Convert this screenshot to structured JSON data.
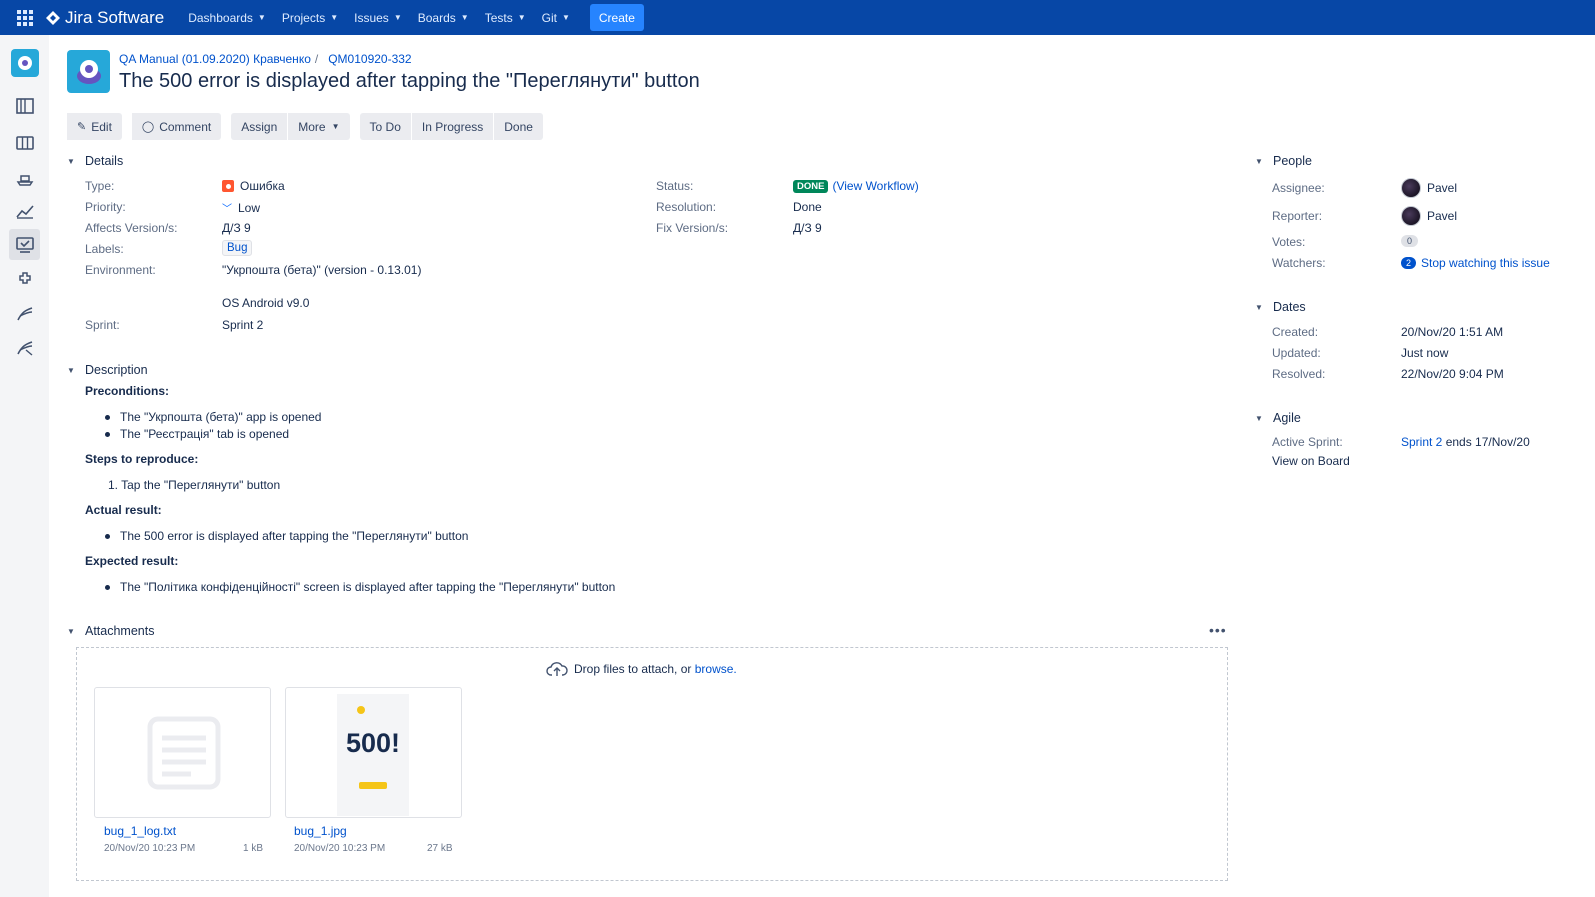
{
  "app": {
    "name": "Jira Software"
  },
  "nav": [
    {
      "label": "Dashboards"
    },
    {
      "label": "Projects"
    },
    {
      "label": "Issues"
    },
    {
      "label": "Boards"
    },
    {
      "label": "Tests"
    },
    {
      "label": "Git"
    }
  ],
  "create_label": "Create",
  "breadcrumb": {
    "project": "QA Manual (01.09.2020) Кравченко",
    "separator": "/",
    "issue_key": "QM010920-332"
  },
  "issue": {
    "title": "The 500 error is displayed after tapping the \"Переглянути\" button"
  },
  "toolbar": {
    "edit": "Edit",
    "comment": "Comment",
    "assign": "Assign",
    "more": "More",
    "todo": "To Do",
    "in_progress": "In Progress",
    "done": "Done"
  },
  "details": {
    "heading": "Details",
    "type_label": "Type:",
    "type_value": "Ошибка",
    "priority_label": "Priority:",
    "priority_value": "Low",
    "affects_label": "Affects Version/s:",
    "affects_value": "Д/З 9",
    "labels_label": "Labels:",
    "labels_value": "Bug",
    "environment_label": "Environment:",
    "environment_line1": "\"Укрпошта (бета)\" (version - 0.13.01)",
    "environment_line2": "OS Android v9.0",
    "sprint_label": "Sprint:",
    "sprint_value": "Sprint 2",
    "status_label": "Status:",
    "status_value": "DONE",
    "view_workflow": "(View Workflow)",
    "resolution_label": "Resolution:",
    "resolution_value": "Done",
    "fix_label": "Fix Version/s:",
    "fix_value": "Д/З 9"
  },
  "description": {
    "heading": "Description",
    "preconditions_title": "Preconditions:",
    "preconditions": [
      "The \"Укрпошта (бета)\" app is opened",
      "The \"Реєстрація\" tab is opened"
    ],
    "steps_title": "Steps to reproduce:",
    "steps": [
      "1. Tap the \"Переглянути\" button"
    ],
    "actual_title": "Actual result:",
    "actual": [
      "The 500 error is displayed after tapping the \"Переглянути\" button"
    ],
    "expected_title": "Expected result:",
    "expected": [
      "The \"Політика конфіденційності\" screen is displayed after tapping the \"Переглянути\" button"
    ]
  },
  "attachments": {
    "heading": "Attachments",
    "drop_text": "Drop files to attach, or",
    "browse": "browse.",
    "files": [
      {
        "name": "bug_1_log.txt",
        "date": "20/Nov/20 10:23 PM",
        "size": "1 kB"
      },
      {
        "name": "bug_1.jpg",
        "date": "20/Nov/20 10:23 PM",
        "size": "27 kB",
        "preview_text": "500!"
      }
    ]
  },
  "people": {
    "heading": "People",
    "assignee_label": "Assignee:",
    "assignee": "Pavel",
    "reporter_label": "Reporter:",
    "reporter": "Pavel",
    "votes_label": "Votes:",
    "votes": "0",
    "watchers_label": "Watchers:",
    "watchers": "2",
    "watch_link": "Stop watching this issue"
  },
  "dates": {
    "heading": "Dates",
    "created_label": "Created:",
    "created": "20/Nov/20 1:51 AM",
    "updated_label": "Updated:",
    "updated": "Just now",
    "resolved_label": "Resolved:",
    "resolved": "22/Nov/20 9:04 PM"
  },
  "agile": {
    "heading": "Agile",
    "active_sprint_label": "Active Sprint:",
    "sprint_link": "Sprint 2",
    "sprint_ends": "ends 17/Nov/20",
    "view_on_board": "View on Board"
  },
  "colors": {
    "topbar": "#0747a6",
    "create": "#2684ff",
    "link": "#0052cc",
    "done_lozenge": "#00875a",
    "bug": "#ff5630"
  }
}
